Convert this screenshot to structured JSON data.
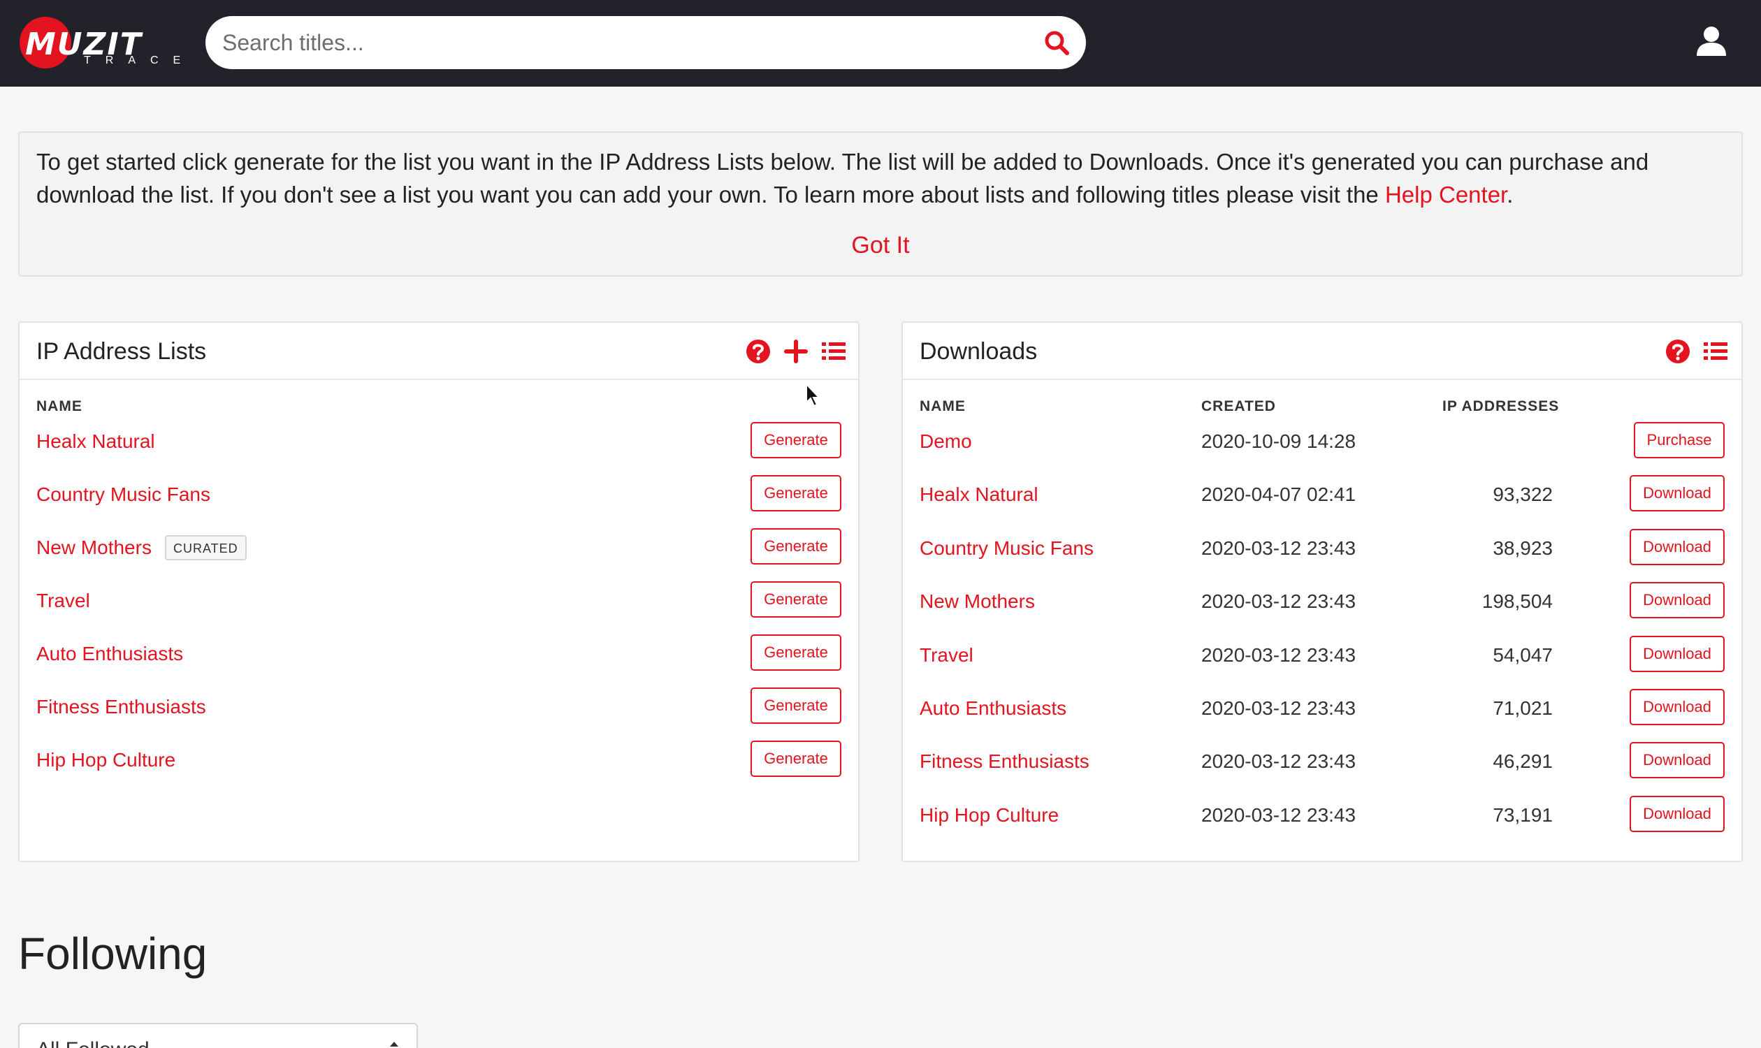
{
  "header": {
    "logo_word": "MUZIT",
    "logo_sub": "TRACE",
    "search_placeholder": "Search titles..."
  },
  "alert": {
    "text_before": "To get started click generate for the list you want in the IP Address Lists below. The list will be added to Downloads. Once it's generated you can purchase and download the list. If you don't see a list you want you can add your own. To learn more about lists and following titles please visit the ",
    "link_label": "Help Center",
    "text_after": ".",
    "dismiss_label": "Got It"
  },
  "ip_lists": {
    "title": "IP Address Lists",
    "col_name": "NAME",
    "button_label": "Generate",
    "rows": [
      {
        "name": "Healx Natural",
        "badge": ""
      },
      {
        "name": "Country Music Fans",
        "badge": ""
      },
      {
        "name": "New Mothers",
        "badge": "CURATED"
      },
      {
        "name": "Travel",
        "badge": ""
      },
      {
        "name": "Auto Enthusiasts",
        "badge": ""
      },
      {
        "name": "Fitness Enthusiasts",
        "badge": ""
      },
      {
        "name": "Hip Hop Culture",
        "badge": ""
      }
    ]
  },
  "downloads": {
    "title": "Downloads",
    "col_name": "NAME",
    "col_created": "CREATED",
    "col_ips": "IP ADDRESSES",
    "rows": [
      {
        "name": "Demo",
        "created": "2020-10-09 14:28",
        "ips": "",
        "action": "Purchase"
      },
      {
        "name": "Healx Natural",
        "created": "2020-04-07 02:41",
        "ips": "93,322",
        "action": "Download"
      },
      {
        "name": "Country Music Fans",
        "created": "2020-03-12 23:43",
        "ips": "38,923",
        "action": "Download"
      },
      {
        "name": "New Mothers",
        "created": "2020-03-12 23:43",
        "ips": "198,504",
        "action": "Download"
      },
      {
        "name": "Travel",
        "created": "2020-03-12 23:43",
        "ips": "54,047",
        "action": "Download"
      },
      {
        "name": "Auto Enthusiasts",
        "created": "2020-03-12 23:43",
        "ips": "71,021",
        "action": "Download"
      },
      {
        "name": "Fitness Enthusiasts",
        "created": "2020-03-12 23:43",
        "ips": "46,291",
        "action": "Download"
      },
      {
        "name": "Hip Hop Culture",
        "created": "2020-03-12 23:43",
        "ips": "73,191",
        "action": "Download"
      }
    ]
  },
  "following": {
    "title": "Following",
    "filter_value": "All Followed"
  },
  "colors": {
    "accent": "#e3141f",
    "topbar": "#22232a",
    "page_bg": "#f6f6f7"
  },
  "icons": {
    "search": "search-icon",
    "user": "user-icon",
    "help": "question-circle-icon",
    "add": "plus-icon",
    "list": "list-icon"
  }
}
